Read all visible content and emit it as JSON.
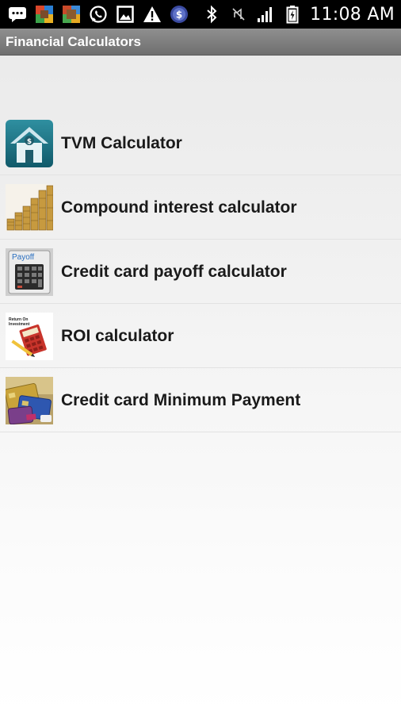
{
  "status_bar": {
    "time": "11:08 AM",
    "left_icons": [
      "message-icon",
      "photo-app-icon",
      "photo-app-icon",
      "whatsapp-icon",
      "image-icon",
      "warning-icon",
      "currency-icon"
    ],
    "right_icons": [
      "bluetooth-icon",
      "mute-icon",
      "signal-icon",
      "battery-icon"
    ]
  },
  "header": {
    "title": "Financial Calculators"
  },
  "calculators": [
    {
      "label": "TVM Calculator",
      "icon": "house-dollar-icon"
    },
    {
      "label": "Compound interest calculator",
      "icon": "coin-stacks-icon"
    },
    {
      "label": "Credit card payoff calculator",
      "icon": "payoff-calculator-icon",
      "icon_text": "Payoff"
    },
    {
      "label": "ROI calculator",
      "icon": "roi-book-icon",
      "icon_text": "Return On Investment"
    },
    {
      "label": "Credit card Minimum Payment",
      "icon": "credit-cards-icon"
    }
  ],
  "colors": {
    "status_bar_bg": "#000000",
    "title_bar_bg": "#7f7f7f",
    "list_text": "#1a1a1a"
  }
}
